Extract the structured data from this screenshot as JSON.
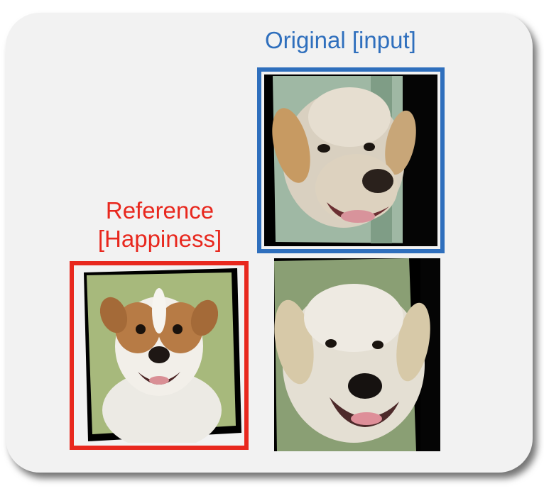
{
  "labels": {
    "original": "Original [input]",
    "reference_line1": "Reference",
    "reference_line2": "[Happiness]"
  },
  "colors": {
    "original_frame": "#2f6fbd",
    "reference_frame": "#e8281e",
    "panel_bg": "#f2f2f2"
  },
  "images": {
    "original": "original-dog-image",
    "reference": "reference-puppy-image",
    "output": "output-dog-image"
  }
}
